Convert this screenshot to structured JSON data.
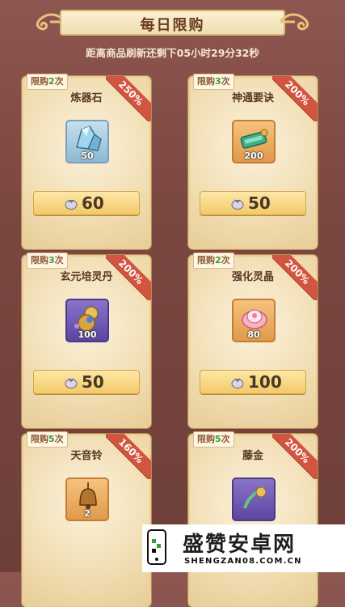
{
  "header": {
    "title": "每日限购"
  },
  "timer": {
    "text": "距离商品刷新还剩下05小时29分32秒"
  },
  "cards": [
    {
      "limit_prefix": "限购",
      "limit_count": "2",
      "limit_suffix": "次",
      "discount": "250%",
      "name": "炼器石",
      "quantity": "50",
      "price": "60",
      "icon": "crystal-ore-icon",
      "frame": "blue"
    },
    {
      "limit_prefix": "限购",
      "limit_count": "3",
      "limit_suffix": "次",
      "discount": "200%",
      "name": "神通要诀",
      "quantity": "200",
      "price": "50",
      "icon": "jade-scroll-icon",
      "frame": "orange"
    },
    {
      "limit_prefix": "限购",
      "limit_count": "3",
      "limit_suffix": "次",
      "discount": "200%",
      "name": "玄元培灵丹",
      "quantity": "100",
      "price": "50",
      "icon": "gourd-pill-icon",
      "frame": "purple"
    },
    {
      "limit_prefix": "限购",
      "limit_count": "2",
      "limit_suffix": "次",
      "discount": "200%",
      "name": "强化灵晶",
      "quantity": "80",
      "price": "100",
      "icon": "lotus-crystal-icon",
      "frame": "orange"
    },
    {
      "limit_prefix": "限购",
      "limit_count": "5",
      "limit_suffix": "次",
      "discount": "160%",
      "name": "天音铃",
      "quantity": "2",
      "price": "",
      "icon": "bell-icon",
      "frame": "orange"
    },
    {
      "limit_prefix": "限购",
      "limit_count": "5",
      "limit_suffix": "次",
      "discount": "200%",
      "name": "藤金",
      "quantity": "",
      "price": "",
      "icon": "vine-gold-icon",
      "frame": "purple"
    }
  ],
  "watermark": {
    "title": "盛赞安卓网",
    "url": "SHENGZAN08.COM.CN"
  }
}
